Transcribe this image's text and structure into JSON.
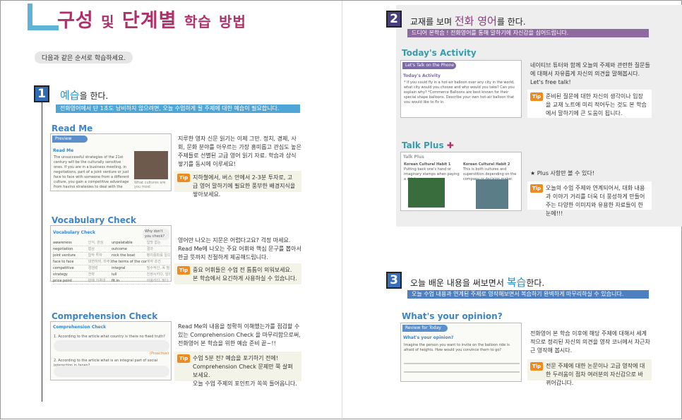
{
  "title": {
    "part1": "구성",
    "connector1": "및",
    "part2": "단계별",
    "part3": "학습",
    "part4": "방법"
  },
  "intro": "다음과 같은 순서로 학습하세요.",
  "step1": {
    "number": "1",
    "keyword": "예습",
    "suffix": "을 한다.",
    "banner": "전화영어에서 단 1초도 낭비하지 않으려면, 오늘 수업하게 될 주제에 대한 예습이 필요합니다."
  },
  "readme": {
    "title": "Read Me",
    "thumb_strip": "Preview",
    "thumb_label": "Read Me",
    "thumb_text": "The unsuccessful strategies of the 21st century will be the culturally sensitive ones. If you are in a business meeting, in negotiations, part of a joint venture or just face to face with someone from a different culture, you gain a competitive advantage from having strategies to deal with the cultural differences you will encounter.",
    "caption": "What cultures are you most unfamiliar with?",
    "desc": "지루한 영자 신문 읽기는 이제 그만. 정치, 경제, 사회, 문화 분야를 아우르는 가장 흥미롭고 관심도 높은 주제들로 선별된 고급 영어 읽기 자료. 학습과 상식 쌓기를 동시에 이루세요!",
    "tip": "지하철에서, 버스 안에서 2-3분 투자로, 고급 영어 말하기에 필요한 풍부한 배경지식을 쌓아보세요."
  },
  "vocab": {
    "title": "Vocabulary Check",
    "thumb_label": "Vocabulary Check",
    "bubble": "Why don't you check?",
    "rows": [
      [
        "awareness",
        "인식, 관심",
        "unpalatable",
        "입맛 없는"
      ],
      [
        "negotiation",
        "협상",
        "outcome",
        "결과"
      ],
      [
        "joint venture",
        "합작 투자",
        "rock the boat",
        "평지풍파를 일으키다"
      ],
      [
        "face to face",
        "대면하여, 마주보고",
        "the terms of the contract",
        "계약 조건"
      ],
      [
        "competitive",
        "경쟁력",
        "integral",
        "필수적인, 꼭 필요한"
      ],
      [
        "strategy",
        "전략",
        "lull",
        "진정시키다, 달래다"
      ],
      [
        "price point",
        "판매 가격대",
        "fit in",
        "어울리다, 맞다"
      ]
    ],
    "desc": "영어만 나오는 지문은 어렵다고요? 걱정 마세요. Read Me에 나오는 주요 어휘와 핵심 문구를 뽑아서 한글 뜻까지 친절하게 제공해드립니다.",
    "tip": "중요 어휘들은 수업 전 틈틈이 외워보세요. 본 학습에서 요긴하게 사용하실 수 있습니다."
  },
  "comp": {
    "title": "Comprehension Check",
    "thumb_label": "Comprehension Check",
    "q1": "1. According to the article what country is there no fixed truth?",
    "q2": "2. According to the article what is an integral part of social interaction in Japan?",
    "hint": "(Proactive)",
    "desc": "Read Me의 내용을 정확히 이해했는가를 점검할 수 있는 Comprehension Check 을 마무리함으로써, 전화영어 본 학습을 위한 예습 준비 끝~!!",
    "tip_line1": "수업 5분 전? 예습을 포기하기 전에!",
    "tip_line2": "Comprehension Check 문제만 쭉 살펴보세요.",
    "tip_line3": "오늘 수업 주제의 포인트가 쏙쏙 들어옵니다."
  },
  "step2": {
    "number": "2",
    "prefix": "교재를 보며",
    "keyword": "전화 영어",
    "suffix": "를 한다.",
    "banner": "드디어 본학습 ! 전화영어를 통해 말하기에 자신감을 심어드립니다."
  },
  "activity": {
    "title": "Today's Activity",
    "thumb_strip": "Let's Talk on the Phone",
    "thumb_label": "Today's Activity",
    "thumb_text": "* If you could fly in a hot-air balloon over any city in the world, what city would you choose and who would you take? Can you explain why? *Commerce Balloons are best known for their special shape balloons. Describe your own hot-air balloon that you would like to fly in.",
    "desc": "네이티브 튜터와 함께 오늘의 주제와 관련한 질문들에 대해서 자유롭게 자신의 의견을 말해봅시다. Let's free talk!",
    "tip": "준비된 질문에 대한 자신의 생각이나 입장을 교재 노트에 미리 적어두는 것도 본 학습에서 말하기에 큰 도움이 됩니다."
  },
  "talkplus": {
    "title": "Talk Plus",
    "thumb_label": "Talk Plus",
    "col1_title": "Korean Cultural Habit 1",
    "col1_text": "Putting back one's hand or imaginary stamps when paying a drink.",
    "col2_title": "Korean Cultural Habit 2",
    "col2_text": "This is both cultures and superstition depending on the company or decision maker.",
    "star_note": "★ Plus 사항만 볼 수 있다!",
    "tip": "오늘의 수업 주제와 연계되어서, 대화 내용과 이야기 거리를 더욱 더 풍성하게 만들어 주는 다양한 이미지와 유용한 자료들이 한 눈에!!!"
  },
  "step3": {
    "number": "3",
    "prefix": "오늘 배운 내용을 써보면서",
    "keyword": "복습",
    "suffix": "한다.",
    "banner": "오늘 수업 내용과 연계된 주제로 영작해보면서 복습하기 완벽하게 마무리하실 수 있습니다."
  },
  "opinion": {
    "title": "What's your opinion?",
    "thumb_strip": "Review for Today",
    "thumb_label": "What's your opinion?",
    "thumb_text": "Imagine the person you want to invite on the balloon ride is afraid of heights. How would you convince them to go?",
    "desc": "전화영어 본 학습 이후에 해당 주제에 대해서 세계적으로 정리된 자신의 의견을 영작 코너에서 차근차근 영작해 봅시다.",
    "tip": "전문 주제에 대한 논문이나 고급 영작에 대한 두려움이 점차 여러분의 자신감으로 바뀌어갑니다."
  },
  "tip_label": "Tip",
  "colors": {
    "accent_blue": "#3d85c6",
    "title_pink": "#b0306b",
    "tip_orange": "#f08a1c"
  }
}
